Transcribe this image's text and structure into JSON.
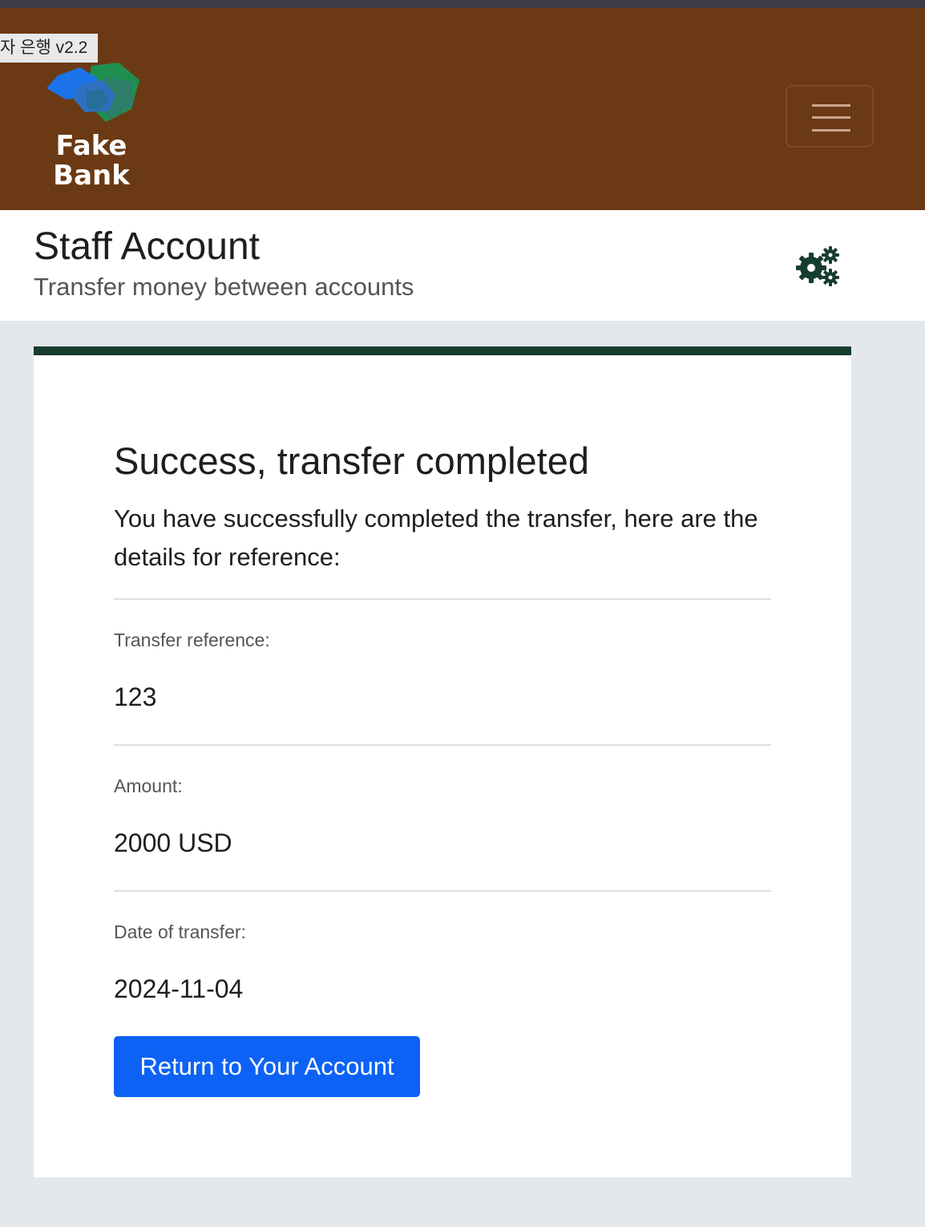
{
  "header": {
    "version_tag": "자 은행 v2.2",
    "logo_line1": "Fake",
    "logo_line2": "Bank",
    "brand_color": "#6b3a14"
  },
  "page": {
    "title": "Staff Account",
    "subtitle": "Transfer money between accounts"
  },
  "card": {
    "title": "Success, transfer completed",
    "message": "You have successfully completed the transfer, here are the details for reference:",
    "fields": [
      {
        "label": "Transfer reference:",
        "value": "123"
      },
      {
        "label": "Amount:",
        "value": "2000 USD"
      },
      {
        "label": "Date of transfer:",
        "value": "2024-11-04"
      }
    ],
    "return_button": "Return to Your Account",
    "accent_color": "#173d2f",
    "button_color": "#0d62f5"
  },
  "icons": {
    "menu": "hamburger-menu-icon",
    "settings": "gears-icon",
    "logo": "fake-bank-logo"
  }
}
